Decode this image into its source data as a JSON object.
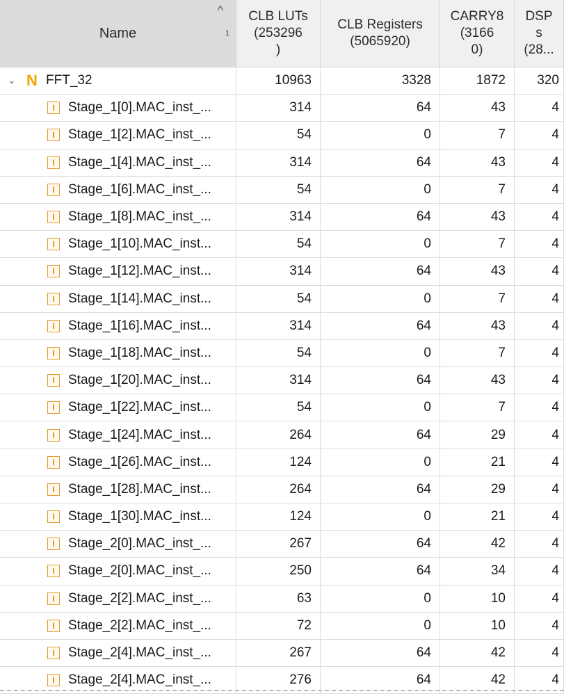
{
  "header": {
    "name": "Name",
    "sort_index": "1",
    "columns": [
      "CLB LUTs\n(253296\n)",
      "CLB Registers\n(5065920)",
      "CARRY8\n(3166\n0)",
      "DSP\ns\n(28..."
    ]
  },
  "top": {
    "label": "FFT_32",
    "luts": "10963",
    "regs": "3328",
    "carry": "1872",
    "dsp": "320"
  },
  "rows": [
    {
      "name": "Stage_1[0].MAC_inst_...",
      "luts": "314",
      "regs": "64",
      "carry": "43",
      "dsp": "4"
    },
    {
      "name": "Stage_1[2].MAC_inst_...",
      "luts": "54",
      "regs": "0",
      "carry": "7",
      "dsp": "4"
    },
    {
      "name": "Stage_1[4].MAC_inst_...",
      "luts": "314",
      "regs": "64",
      "carry": "43",
      "dsp": "4"
    },
    {
      "name": "Stage_1[6].MAC_inst_...",
      "luts": "54",
      "regs": "0",
      "carry": "7",
      "dsp": "4"
    },
    {
      "name": "Stage_1[8].MAC_inst_...",
      "luts": "314",
      "regs": "64",
      "carry": "43",
      "dsp": "4"
    },
    {
      "name": "Stage_1[10].MAC_inst...",
      "luts": "54",
      "regs": "0",
      "carry": "7",
      "dsp": "4"
    },
    {
      "name": "Stage_1[12].MAC_inst...",
      "luts": "314",
      "regs": "64",
      "carry": "43",
      "dsp": "4"
    },
    {
      "name": "Stage_1[14].MAC_inst...",
      "luts": "54",
      "regs": "0",
      "carry": "7",
      "dsp": "4"
    },
    {
      "name": "Stage_1[16].MAC_inst...",
      "luts": "314",
      "regs": "64",
      "carry": "43",
      "dsp": "4"
    },
    {
      "name": "Stage_1[18].MAC_inst...",
      "luts": "54",
      "regs": "0",
      "carry": "7",
      "dsp": "4"
    },
    {
      "name": "Stage_1[20].MAC_inst...",
      "luts": "314",
      "regs": "64",
      "carry": "43",
      "dsp": "4"
    },
    {
      "name": "Stage_1[22].MAC_inst...",
      "luts": "54",
      "regs": "0",
      "carry": "7",
      "dsp": "4"
    },
    {
      "name": "Stage_1[24].MAC_inst...",
      "luts": "264",
      "regs": "64",
      "carry": "29",
      "dsp": "4"
    },
    {
      "name": "Stage_1[26].MAC_inst...",
      "luts": "124",
      "regs": "0",
      "carry": "21",
      "dsp": "4"
    },
    {
      "name": "Stage_1[28].MAC_inst...",
      "luts": "264",
      "regs": "64",
      "carry": "29",
      "dsp": "4"
    },
    {
      "name": "Stage_1[30].MAC_inst...",
      "luts": "124",
      "regs": "0",
      "carry": "21",
      "dsp": "4"
    },
    {
      "name": "Stage_2[0].MAC_inst_...",
      "luts": "267",
      "regs": "64",
      "carry": "42",
      "dsp": "4"
    },
    {
      "name": "Stage_2[0].MAC_inst_...",
      "luts": "250",
      "regs": "64",
      "carry": "34",
      "dsp": "4"
    },
    {
      "name": "Stage_2[2].MAC_inst_...",
      "luts": "63",
      "regs": "0",
      "carry": "10",
      "dsp": "4"
    },
    {
      "name": "Stage_2[2].MAC_inst_...",
      "luts": "72",
      "regs": "0",
      "carry": "10",
      "dsp": "4"
    },
    {
      "name": "Stage_2[4].MAC_inst_...",
      "luts": "267",
      "regs": "64",
      "carry": "42",
      "dsp": "4"
    },
    {
      "name": "Stage_2[4].MAC_inst_...",
      "luts": "276",
      "regs": "64",
      "carry": "42",
      "dsp": "4"
    }
  ]
}
